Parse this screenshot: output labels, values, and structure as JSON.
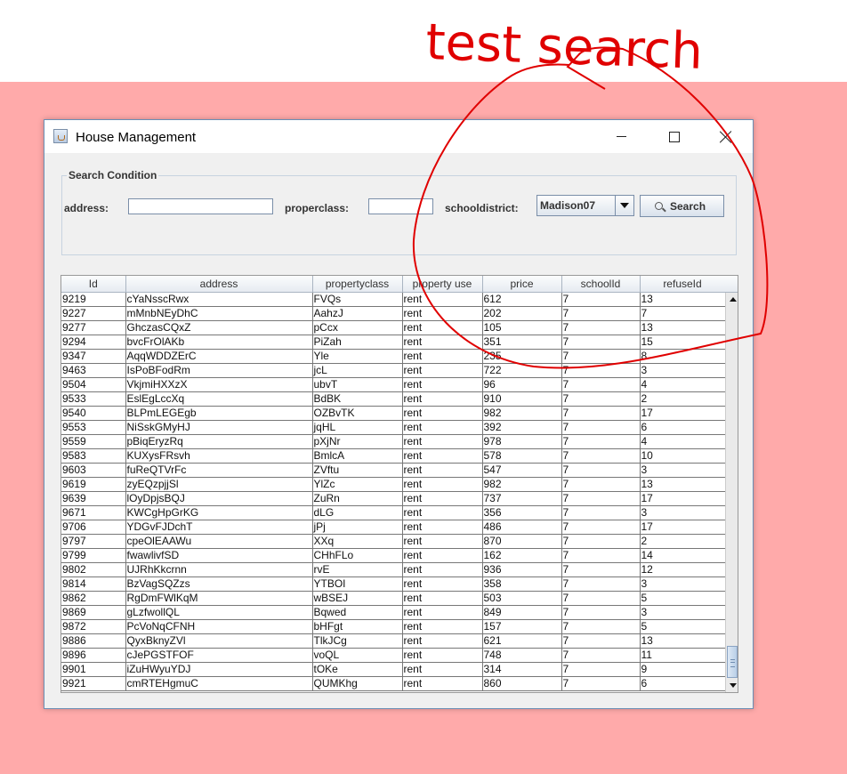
{
  "window": {
    "title": "House Management"
  },
  "search": {
    "legend": "Search Condition",
    "address_label": "address:",
    "address_value": "",
    "properclass_label": "properclass:",
    "properclass_value": "",
    "schooldistrict_label": "schooldistrict:",
    "schooldistrict_value": "Madison07",
    "search_label": "Search"
  },
  "table": {
    "columns": [
      "Id",
      "address",
      "propertyclass",
      "property use",
      "price",
      "schoolId",
      "refuseId"
    ],
    "rows": [
      [
        "9219",
        "cYaNsscRwx",
        "FVQs",
        "rent",
        "612",
        "7",
        "13"
      ],
      [
        "9227",
        "mMnbNEyDhC",
        "AahzJ",
        "rent",
        "202",
        "7",
        "7"
      ],
      [
        "9277",
        "GhczasCQxZ",
        "pCcx",
        "rent",
        "105",
        "7",
        "13"
      ],
      [
        "9294",
        "bvcFrOlAKb",
        "PiZah",
        "rent",
        "351",
        "7",
        "15"
      ],
      [
        "9347",
        "AqqWDDZErC",
        "Yle",
        "rent",
        "235",
        "7",
        "8"
      ],
      [
        "9463",
        "IsPoBFodRm",
        "jcL",
        "rent",
        "722",
        "7",
        "3"
      ],
      [
        "9504",
        "VkjmiHXXzX",
        "ubvT",
        "rent",
        "96",
        "7",
        "4"
      ],
      [
        "9533",
        "EslEgLccXq",
        "BdBK",
        "rent",
        "910",
        "7",
        "2"
      ],
      [
        "9540",
        "BLPmLEGEgb",
        "OZBvTK",
        "rent",
        "982",
        "7",
        "17"
      ],
      [
        "9553",
        "NiSskGMyHJ",
        "jqHL",
        "rent",
        "392",
        "7",
        "6"
      ],
      [
        "9559",
        "pBiqEryzRq",
        "pXjNr",
        "rent",
        "978",
        "7",
        "4"
      ],
      [
        "9583",
        "KUXysFRsvh",
        "BmlcA",
        "rent",
        "578",
        "7",
        "10"
      ],
      [
        "9603",
        "fuReQTVrFc",
        "ZVftu",
        "rent",
        "547",
        "7",
        "3"
      ],
      [
        "9619",
        "zyEQzpjjSl",
        "YlZc",
        "rent",
        "982",
        "7",
        "13"
      ],
      [
        "9639",
        "lOyDpjsBQJ",
        "ZuRn",
        "rent",
        "737",
        "7",
        "17"
      ],
      [
        "9671",
        "KWCgHpGrKG",
        "dLG",
        "rent",
        "356",
        "7",
        "3"
      ],
      [
        "9706",
        "YDGvFJDchT",
        "jPj",
        "rent",
        "486",
        "7",
        "17"
      ],
      [
        "9797",
        "cpeOlEAAWu",
        "XXq",
        "rent",
        "870",
        "7",
        "2"
      ],
      [
        "9799",
        "fwawlivfSD",
        "CHhFLo",
        "rent",
        "162",
        "7",
        "14"
      ],
      [
        "9802",
        "UJRhKkcrnn",
        "rvE",
        "rent",
        "936",
        "7",
        "12"
      ],
      [
        "9814",
        "BzVagSQZzs",
        "YTBOI",
        "rent",
        "358",
        "7",
        "3"
      ],
      [
        "9862",
        "RgDmFWlKqM",
        "wBSEJ",
        "rent",
        "503",
        "7",
        "5"
      ],
      [
        "9869",
        "gLzfwollQL",
        "Bqwed",
        "rent",
        "849",
        "7",
        "3"
      ],
      [
        "9872",
        "PcVoNqCFNH",
        "bHFgt",
        "rent",
        "157",
        "7",
        "5"
      ],
      [
        "9886",
        "QyxBknyZVl",
        "TlkJCg",
        "rent",
        "621",
        "7",
        "13"
      ],
      [
        "9896",
        "cJePGSTFOF",
        "voQL",
        "rent",
        "748",
        "7",
        "11"
      ],
      [
        "9901",
        "iZuHWyuYDJ",
        "tOKe",
        "rent",
        "314",
        "7",
        "9"
      ],
      [
        "9921",
        "cmRTEHgmuC",
        "QUMKhg",
        "rent",
        "860",
        "7",
        "6"
      ]
    ]
  },
  "annotation": {
    "text": "test search",
    "color": "#e00000"
  },
  "colors": {
    "background": "#ffaaaa",
    "annotation": "#e00000"
  },
  "icons": {
    "app": "java-cup-icon",
    "search": "magnifier-icon"
  }
}
